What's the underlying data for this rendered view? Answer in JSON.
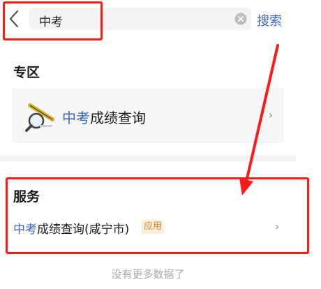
{
  "search": {
    "value": "中考",
    "button_label": "搜索"
  },
  "zone": {
    "title": "专区",
    "card": {
      "highlight": "中考",
      "rest": "成绩查询",
      "chevron": "›"
    }
  },
  "services": {
    "title": "服务",
    "items": [
      {
        "highlight": "中考",
        "rest": "成绩查询(咸宁市)",
        "badge": "应用",
        "chevron": "›"
      }
    ]
  },
  "footer": {
    "no_more": "没有更多数据了"
  },
  "colors": {
    "accent": "#3b63c4",
    "annotation": "#ff1a1a",
    "badge_bg": "#fbeedc",
    "badge_text": "#d38a28"
  }
}
